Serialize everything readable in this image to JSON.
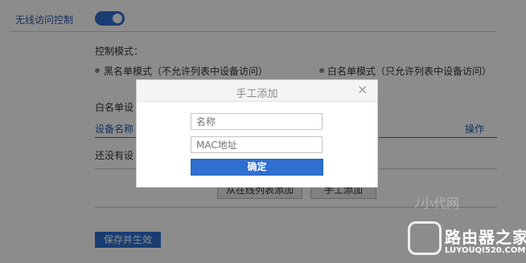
{
  "page": {
    "wireless_access_control_label": "无线访问控制",
    "toggle_on": true,
    "control_mode_title": "控制模式：",
    "blacklist_mode_label": "黑名单模式（不允许列表中设备访问）",
    "whitelist_mode_label": "白名单模式（只允许列表中设备访问）",
    "whitelist_title": "白名单设",
    "col_device_name": "设备名称",
    "col_operation": "操作",
    "empty_text": "还没有设",
    "add_from_list_button": "从在线列表添加",
    "manual_add_button": "手工添加",
    "save_button": "保存并生效",
    "accent_color": "#2e6fd0"
  },
  "modal": {
    "title": "手工添加",
    "close_icon": "×",
    "name_placeholder": "名称",
    "mac_placeholder": "MAC地址",
    "confirm_button": "确定"
  },
  "watermark": {
    "brand": "路由器之家",
    "url": "LUYOUQI520.COM",
    "faint": "ﾉ小代网"
  }
}
